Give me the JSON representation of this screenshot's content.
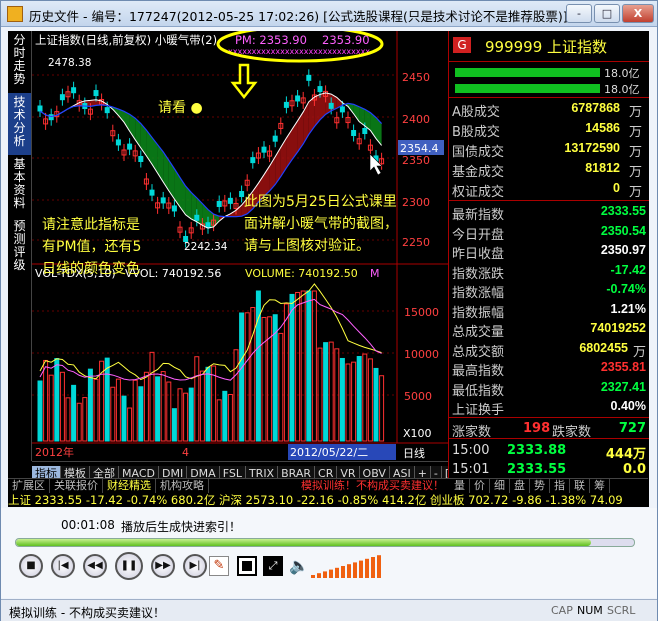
{
  "window": {
    "title": "历史文件 - 编号：177247(2012-05-25 17:02:26) [公式选股课程(只是技术讨论不是推荐股票)]",
    "btn_min": "-",
    "btn_max": "□",
    "btn_close": "X"
  },
  "left_tabs": [
    "分时走势",
    "技术分析",
    "基本资料",
    "预测评级"
  ],
  "main_chart": {
    "title": "上证指数(日线,前复权) 小暖气带(2)",
    "pm_label": "PM: 2353.90",
    "pm_value": "2353.90",
    "high_label": "2478.38",
    "low_label": "2242.34",
    "current_label": "2354.4",
    "y_ticks": [
      "2450",
      "2400",
      "2350",
      "2300",
      "2250"
    ]
  },
  "annotations": {
    "top": "请看",
    "left": "请注意此指标是\n有PM值，还有5\n日线的颜色变色",
    "right": "此图为5月25日公式课里\n面讲解小暖气带的截图，\n请与上图核对验证。"
  },
  "volume_chart": {
    "indicator": "VOL-TDX(5,10)",
    "vvol_label": "VVOL: 740192.56",
    "volume_label": "VOLUME: 740192.50",
    "m_label": "M",
    "y_ticks": [
      "15000",
      "10000",
      "5000"
    ],
    "multiplier": "X100",
    "period": "日线"
  },
  "time_axis": {
    "year": "2012年",
    "month": "4",
    "cursor_date": "2012/05/22/二"
  },
  "bottom_tabs": [
    "指标",
    "模板",
    "全部",
    "MACD",
    "DMI",
    "DMA",
    "FSL",
    "TRIX",
    "BRAR",
    "CR",
    "VR",
    "OBV",
    "ASI",
    "+",
    "-",
    "[]"
  ],
  "status_tabs": {
    "left": [
      "扩展区",
      "关联报价",
      "财经精选",
      "机构攻略"
    ],
    "mid": "模拟训练！不构成买卖建议！",
    "right": [
      "量",
      "价",
      "细",
      "盘",
      "势",
      "指",
      "联",
      "筹"
    ]
  },
  "ticker": "上证 2333.55  -17.42  -0.74%  680.2亿  沪深 2573.10  -22.16  -0.85%  414.2亿  创业板 702.72  -9.86  -1.38%  74.09",
  "right_panel": {
    "badge": "G",
    "code": "999999",
    "name": "上证指数",
    "bar1": "18.0亿",
    "bar2": "18.0亿",
    "rows1": [
      {
        "l": "A股成交",
        "v": "6787868",
        "u": "万",
        "c": "#ffff40"
      },
      {
        "l": "B股成交",
        "v": "14586",
        "u": "万",
        "c": "#ffff40"
      },
      {
        "l": "国债成交",
        "v": "13172590",
        "u": "万",
        "c": "#ffff40"
      },
      {
        "l": "基金成交",
        "v": "81812",
        "u": "万",
        "c": "#ffff40"
      },
      {
        "l": "权证成交",
        "v": "0",
        "u": "万",
        "c": "#ffff40"
      }
    ],
    "rows2": [
      {
        "l": "最新指数",
        "v": "2333.55",
        "c": "#00ff40"
      },
      {
        "l": "今日开盘",
        "v": "2350.54",
        "c": "#00ff40"
      },
      {
        "l": "昨日收盘",
        "v": "2350.97",
        "c": "#ffffff"
      },
      {
        "l": "指数涨跌",
        "v": "-17.42",
        "c": "#00ff40"
      },
      {
        "l": "指数涨幅",
        "v": "-0.74%",
        "c": "#00ff40"
      },
      {
        "l": "指数振幅",
        "v": "1.21%",
        "c": "#ffffff"
      },
      {
        "l": "总成交量",
        "v": "74019252",
        "c": "#ffff40"
      },
      {
        "l": "总成交额",
        "v": "6802455",
        "u": "万",
        "c": "#ffff40"
      },
      {
        "l": "最高指数",
        "v": "2355.81",
        "c": "#ff3030"
      },
      {
        "l": "最低指数",
        "v": "2327.41",
        "c": "#00ff40"
      },
      {
        "l": "上证换手",
        "v": "0.40%",
        "c": "#ffffff"
      }
    ],
    "up_label": "涨家数",
    "up_value": "198",
    "down_label": "跌家数",
    "down_value": "727",
    "ticks": [
      {
        "t": "15:00",
        "p": "2333.88",
        "v": "444万"
      },
      {
        "t": "15:01",
        "p": "2333.55",
        "v": "0.0"
      }
    ]
  },
  "player": {
    "time": "00:01:08",
    "message": "播放后生成快进索引！",
    "progress": 0.93,
    "buttons": [
      "stop-icon",
      "prev-icon",
      "rewind-icon",
      "pause-icon",
      "forward-icon",
      "next-icon"
    ]
  },
  "statusbar": {
    "text": "模拟训练 - 不构成买卖建议！",
    "cap": "CAP",
    "num": "NUM",
    "scrl": "SCRL"
  },
  "colors": {
    "up": "#ff3030",
    "down": "#00d8d8",
    "ma_green": "#00c040",
    "band_red": "#a01010",
    "band_green": "#0a8a1a",
    "yellow": "#ffff40"
  }
}
